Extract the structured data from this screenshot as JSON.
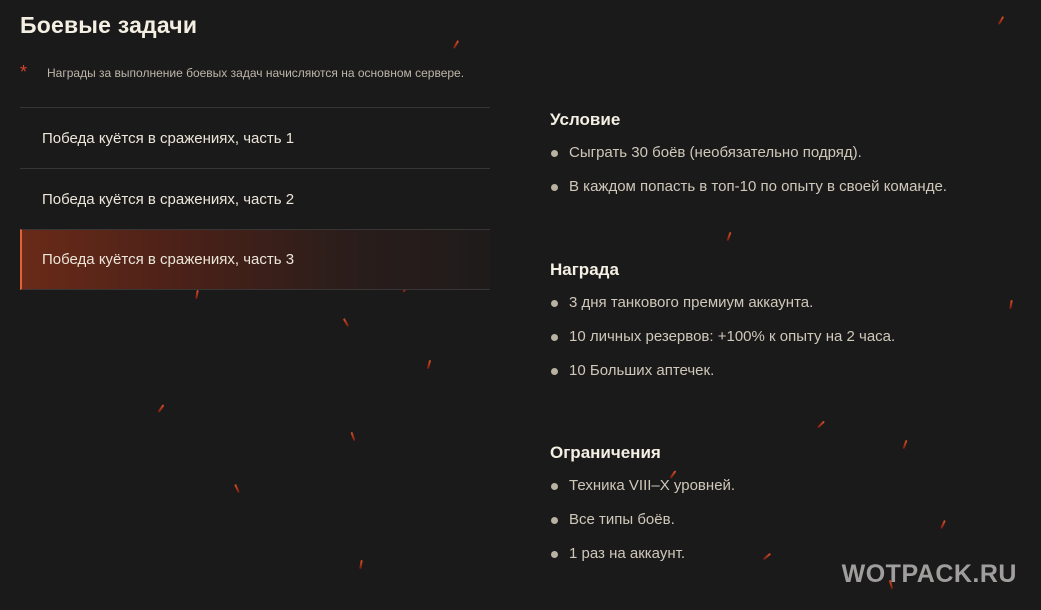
{
  "page": {
    "title": "Боевые задачи",
    "note_marker": "*",
    "note": "Награды за выполнение боевых задач начисляются на основном сервере."
  },
  "tasks": [
    {
      "label": "Победа куётся в сражениях, часть 1",
      "active": false
    },
    {
      "label": "Победа куётся в сражениях, часть 2",
      "active": false
    },
    {
      "label": "Победа куётся в сражениях, часть 3",
      "active": true
    }
  ],
  "details": {
    "condition": {
      "heading": "Условие",
      "items": [
        "Сыграть 30 боёв (необязательно подряд).",
        "В каждом попасть в топ-10 по опыту в своей команде."
      ]
    },
    "reward": {
      "heading": "Награда",
      "items": [
        "3 дня танкового премиум аккаунта.",
        "10 личных резервов: +100% к опыту на 2 часа.",
        "10 Больших аптечек."
      ]
    },
    "restrictions": {
      "heading": "Ограничения",
      "items": [
        "Техника VIII–X уровней.",
        "Все типы боёв.",
        "1 раз на аккаунт."
      ]
    }
  },
  "watermark": "WOTPACK.RU",
  "colors": {
    "background": "#1b1a1b",
    "accent": "#e0623a",
    "active_gradient_start": "#6a2a18"
  }
}
